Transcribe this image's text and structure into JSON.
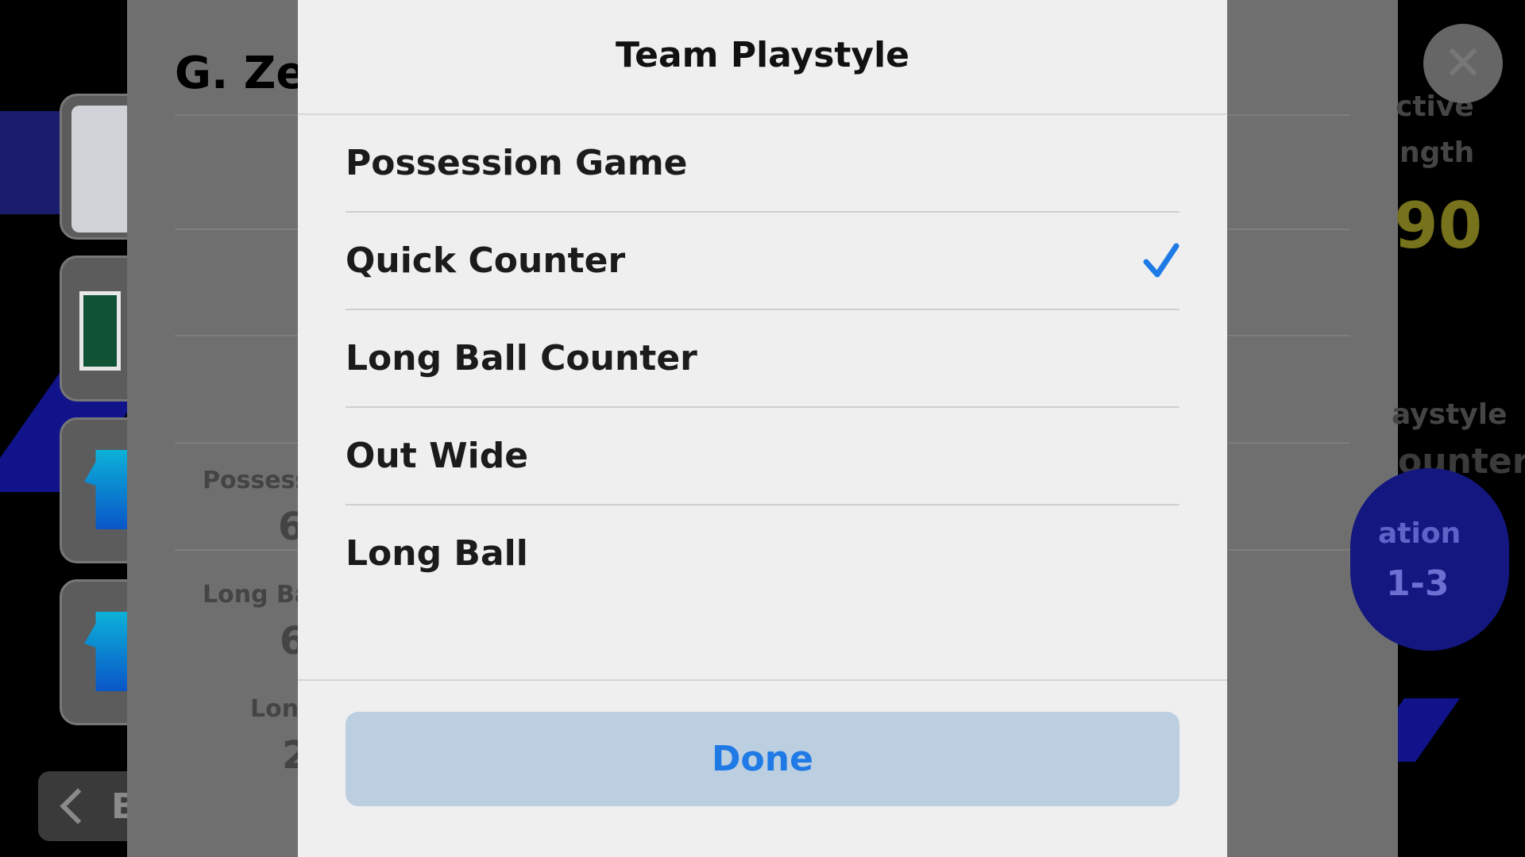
{
  "background": {
    "player_name": "G. Zei",
    "stat_labels": [
      "Possessi",
      "Long Bal",
      "Long"
    ],
    "stat_values": [
      "6",
      "6",
      "2"
    ],
    "right_labels": [
      "ctive",
      "ngth"
    ],
    "team_rating": "90",
    "playstyle_label": "aystyle",
    "playstyle_value": "ounter",
    "formation_label": "ation",
    "formation_value": "1-3",
    "back_label": "B",
    "close_icon": "close-icon"
  },
  "modal": {
    "title": "Team Playstyle",
    "options": [
      {
        "label": "Possession Game",
        "selected": false
      },
      {
        "label": "Quick Counter",
        "selected": true
      },
      {
        "label": "Long Ball Counter",
        "selected": false
      },
      {
        "label": "Out Wide",
        "selected": false
      },
      {
        "label": "Long Ball",
        "selected": false
      }
    ],
    "done_label": "Done"
  },
  "colors": {
    "accent": "#1f7ae6",
    "done_bg": "#bccfe0",
    "modal_bg": "#efefef",
    "check": "#1f7ae6"
  }
}
